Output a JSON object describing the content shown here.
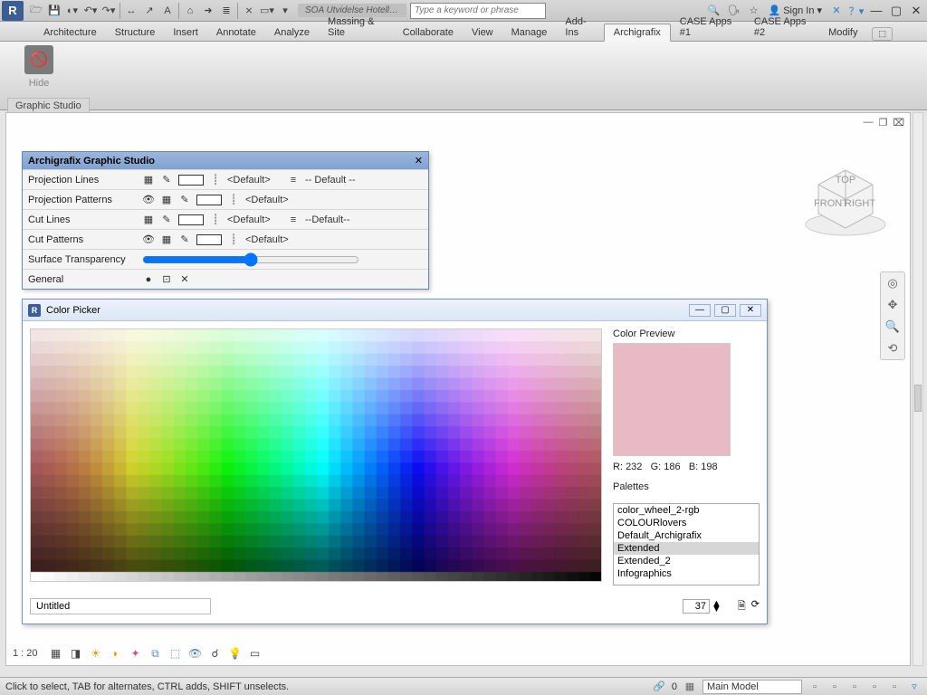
{
  "qat": {
    "doc_tab": "SOA Utvidelse Hotell.rvt...",
    "search_placeholder": "Type a keyword or phrase",
    "sign_in": "Sign In"
  },
  "ribbon": {
    "tabs": [
      "Architecture",
      "Structure",
      "Insert",
      "Annotate",
      "Analyze",
      "Massing & Site",
      "Collaborate",
      "View",
      "Manage",
      "Add-Ins",
      "Archigrafix",
      "CASE Apps #1",
      "CASE Apps #2",
      "Modify"
    ],
    "active_tab_index": 10,
    "panel_btn_label": "Hide",
    "panel_title": "Graphic Studio"
  },
  "gs": {
    "title": "Archigrafix Graphic Studio",
    "rows": [
      {
        "name": "Projection Lines",
        "default": "<Default>",
        "extra": "-- Default --",
        "eye": false
      },
      {
        "name": "Projection Patterns",
        "default": "<Default>",
        "extra": "",
        "eye": true
      },
      {
        "name": "Cut Lines",
        "default": "<Default>",
        "extra": "--Default--",
        "eye": false
      },
      {
        "name": "Cut Patterns",
        "default": "<Default>",
        "extra": "",
        "eye": true
      },
      {
        "name": "Surface Transparency",
        "slider": true
      },
      {
        "name": "General",
        "general": true
      }
    ]
  },
  "cp": {
    "title": "Color Picker",
    "preview_label": "Color Preview",
    "preview_color": "#e8bac6",
    "r_label": "R:",
    "g_label": "G:",
    "b_label": "B:",
    "r": 232,
    "g": 186,
    "b": 198,
    "palettes_label": "Palettes",
    "palettes": [
      "color_wheel_2-rgb",
      "COLOURlovers",
      "Default_Archigrafix",
      "Extended",
      "Extended_2",
      "Infographics"
    ],
    "selected_palette_index": 3,
    "footer_name": "Untitled",
    "footer_value": "37"
  },
  "viewcube": {
    "top": "TOP",
    "front": "FRONT",
    "right": "RIGHT"
  },
  "viewbar": {
    "scale": "1 : 20"
  },
  "status": {
    "msg": "Click to select, TAB for alternates, CTRL adds, SHIFT unselects.",
    "count": "0",
    "model": "Main Model"
  }
}
